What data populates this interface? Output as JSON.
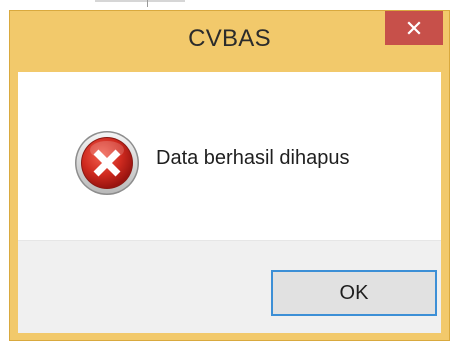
{
  "dialog": {
    "title": "CVBAS",
    "message": "Data berhasil dihapus",
    "icon": "error-icon",
    "ok_label": "OK",
    "close_icon": "close-icon"
  },
  "colors": {
    "titlebar": "#f2c96b",
    "close_button": "#c7504a",
    "button_area": "#f0f0f0",
    "ok_border": "#3c8fd6",
    "error_red": "#c9251f"
  }
}
